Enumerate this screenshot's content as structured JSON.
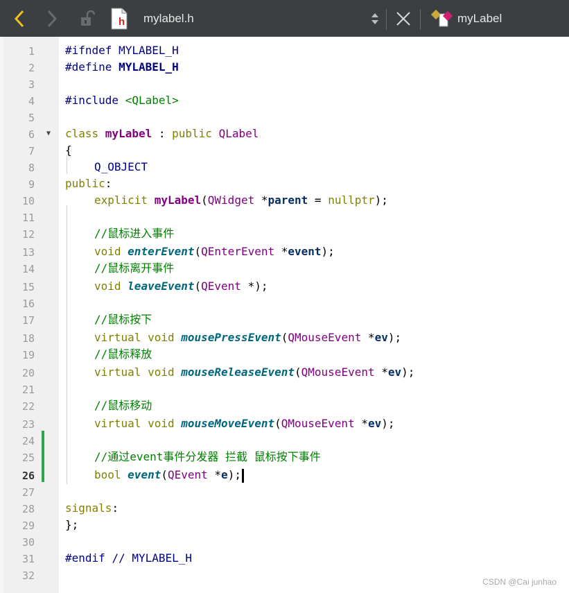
{
  "toolbar": {
    "file_name": "mylabel.h",
    "file_icon_letter": "h",
    "class_name": "myLabel"
  },
  "code_lines": [
    {
      "n": "1"
    },
    {
      "n": "2"
    },
    {
      "n": "3"
    },
    {
      "n": "4"
    },
    {
      "n": "5"
    },
    {
      "n": "6"
    },
    {
      "n": "7"
    },
    {
      "n": "8"
    },
    {
      "n": "9"
    },
    {
      "n": "10"
    },
    {
      "n": "11"
    },
    {
      "n": "12"
    },
    {
      "n": "13"
    },
    {
      "n": "14"
    },
    {
      "n": "15"
    },
    {
      "n": "16"
    },
    {
      "n": "17"
    },
    {
      "n": "18"
    },
    {
      "n": "19"
    },
    {
      "n": "20"
    },
    {
      "n": "21"
    },
    {
      "n": "22"
    },
    {
      "n": "23"
    },
    {
      "n": "24"
    },
    {
      "n": "25"
    },
    {
      "n": "26"
    },
    {
      "n": "27"
    },
    {
      "n": "28"
    },
    {
      "n": "29"
    },
    {
      "n": "30"
    },
    {
      "n": "31"
    },
    {
      "n": "32"
    }
  ],
  "code": {
    "l1": {
      "a": "#ifndef ",
      "b": "MYLABEL_H"
    },
    "l2": {
      "a": "#define ",
      "b": "MYLABEL_H"
    },
    "l4": {
      "a": "#include ",
      "b": "<QLabel>"
    },
    "l6": {
      "a": "class ",
      "b": "myLabel",
      "c": " : ",
      "d": "public ",
      "e": "QLabel"
    },
    "l7": {
      "a": "{"
    },
    "l8": {
      "a": "Q_OBJECT"
    },
    "l9": {
      "a": "public",
      ":": ":"
    },
    "l10": {
      "a": "explicit ",
      "b": "myLabel",
      "c": "(",
      "d": "QWidget",
      " e": " *",
      "f": "parent",
      "g": " = ",
      "h": "nullptr",
      "i": ");"
    },
    "l12": {
      "a": "//鼠标进入事件"
    },
    "l13": {
      "a": "void ",
      "b": "enterEvent",
      "c": "(",
      "d": "QEnterEvent",
      " e": " *",
      "f": "event",
      "g": ");"
    },
    "l14": {
      "a": "//鼠标离开事件"
    },
    "l15": {
      "a": "void ",
      "b": "leaveEvent",
      "c": "(",
      "d": "QEvent",
      " e": " *);"
    },
    "l17": {
      "a": "//鼠标按下"
    },
    "l18": {
      "a": "virtual ",
      "a2": "void ",
      "b": "mousePressEvent",
      "c": "(",
      "d": "QMouseEvent",
      " e": " *",
      "f": "ev",
      "g": ");"
    },
    "l19": {
      "a": "//鼠标释放"
    },
    "l20": {
      "a": "virtual ",
      "a2": "void ",
      "b": "mouseReleaseEvent",
      "c": "(",
      "d": "QMouseEvent",
      " e": " *",
      "f": "ev",
      "g": ");"
    },
    "l22": {
      "a": "//鼠标移动"
    },
    "l23": {
      "a": "virtual ",
      "a2": "void ",
      "b": "mouseMoveEvent",
      "c": "(",
      "d": "QMouseEvent",
      " e": " *",
      "f": "ev",
      "g": ");"
    },
    "l25": {
      "a": "//通过event事件分发器 拦截 鼠标按下事件"
    },
    "l26": {
      "a": "bool ",
      "b": "event",
      "c": "(",
      "d": "QEvent",
      " e": " *",
      "f": "e",
      "g": ");"
    },
    "l28": {
      "a": "signals",
      ":": ":"
    },
    "l29": {
      "a": "};"
    },
    "l31": {
      "a": "#endif ",
      "b": "// MYLABEL_H"
    }
  },
  "watermark": "CSDN @Cai junhao",
  "colors": {
    "toolbar_bg": "#3c3f41",
    "gutter_bg": "#f0f0f0",
    "change_bar": "#2ba84a",
    "keyword": "#808000",
    "class_name": "#800080",
    "comment": "#008000",
    "macro": "#000080"
  },
  "icons": [
    "back-arrow-icon",
    "forward-arrow-icon",
    "lock-icon",
    "header-file-icon",
    "updown-icon",
    "close-icon",
    "class-icon",
    "fold-arrow-icon"
  ]
}
